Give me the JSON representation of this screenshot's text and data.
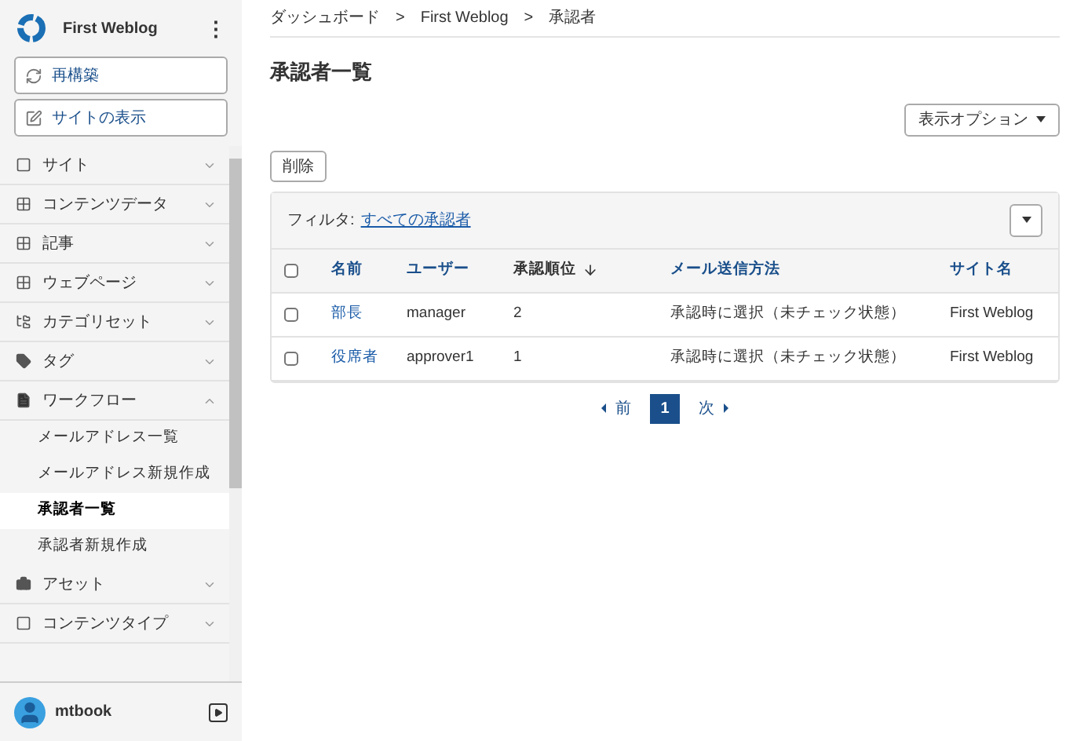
{
  "site": {
    "name": "First Weblog",
    "menu_icon": "⋮"
  },
  "actions": [
    {
      "kind": "rebuild",
      "label": "再構築"
    },
    {
      "kind": "view",
      "label": "サイトの表示"
    }
  ],
  "nav": [
    {
      "kind": "site",
      "label": "サイト",
      "expanded": false
    },
    {
      "kind": "grid",
      "label": "コンテンツデータ",
      "expanded": false
    },
    {
      "kind": "grid",
      "label": "記事",
      "expanded": false
    },
    {
      "kind": "grid",
      "label": "ウェブページ",
      "expanded": false
    },
    {
      "kind": "category",
      "label": "カテゴリセット",
      "expanded": false
    },
    {
      "kind": "tag",
      "label": "タグ",
      "expanded": false
    },
    {
      "kind": "workflow",
      "label": "ワークフロー",
      "expanded": true,
      "children": [
        {
          "label": "メールアドレス一覧",
          "selected": false
        },
        {
          "label": "メールアドレス新規作成",
          "selected": false
        },
        {
          "label": "承認者一覧",
          "selected": true
        },
        {
          "label": "承認者新規作成",
          "selected": false
        }
      ]
    },
    {
      "kind": "asset",
      "label": "アセット",
      "expanded": false
    },
    {
      "kind": "contenttype",
      "label": "コンテンツタイプ",
      "expanded": false
    }
  ],
  "user": {
    "name": "mtbook"
  },
  "breadcrumb": [
    "ダッシュボード",
    "First Weblog",
    "承認者"
  ],
  "breadcrumb_separator": ">",
  "title": "承認者一覧",
  "display_options": "表示オプション",
  "delete_button": "削除",
  "filter": {
    "label": "フィルタ:",
    "value": "すべての承認者"
  },
  "table": {
    "select_all_checked": false,
    "columns": [
      {
        "label": "名前",
        "sorted": false
      },
      {
        "label": "ユーザー",
        "sorted": false
      },
      {
        "label": "承認順位",
        "sorted": true
      },
      {
        "label": "メール送信方法",
        "sorted": false
      },
      {
        "label": "サイト名",
        "sorted": false
      }
    ],
    "rows": [
      {
        "checked": false,
        "cells": [
          "部長",
          "manager",
          "2",
          "承認時に選択（未チェック状態）",
          "First Weblog"
        ]
      },
      {
        "checked": false,
        "cells": [
          "役席者",
          "approver1",
          "1",
          "承認時に選択（未チェック状態）",
          "First Weblog"
        ]
      }
    ]
  },
  "pagination": {
    "prev": "前",
    "next": "次",
    "pages": [
      {
        "label": "1",
        "selected": true
      }
    ]
  }
}
